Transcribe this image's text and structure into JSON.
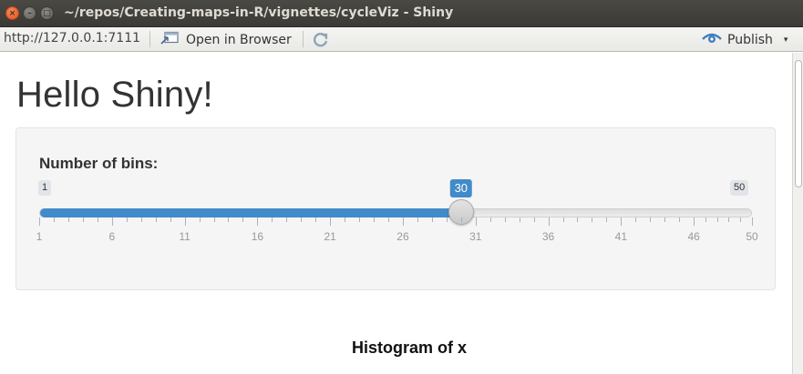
{
  "window": {
    "title": "~/repos/Creating-maps-in-R/vignettes/cycleViz - Shiny",
    "close_glyph": "×",
    "minimize_glyph": "–",
    "maximize_glyph": "□"
  },
  "toolbar": {
    "url": "http://127.0.0.1:7111",
    "open_in_browser": "Open in Browser",
    "publish": "Publish",
    "publish_caret": "▾"
  },
  "page": {
    "title": "Hello Shiny!",
    "slider": {
      "label": "Number of bins:",
      "min": 1,
      "max": 50,
      "value": 30,
      "min_label": "1",
      "max_label": "50",
      "value_label": "30",
      "tick_labels": [
        "1",
        "6",
        "11",
        "16",
        "21",
        "26",
        "31",
        "36",
        "41",
        "46",
        "50"
      ],
      "accent_color": "#428bca"
    },
    "plot": {
      "title": "Histogram of x"
    }
  }
}
